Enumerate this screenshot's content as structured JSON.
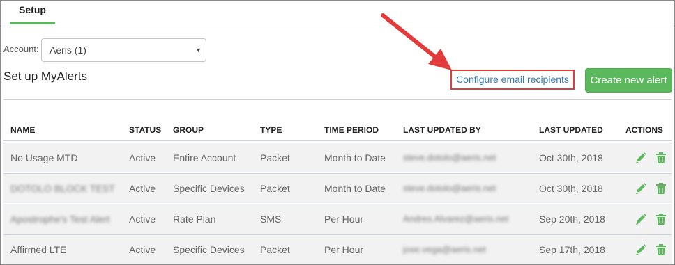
{
  "tabs": [
    {
      "label": "Setup"
    }
  ],
  "account": {
    "label": "Account:",
    "selected": "Aeris (1)"
  },
  "page": {
    "heading": "Set up MyAlerts"
  },
  "actions": {
    "configure_label": "Configure email recipients",
    "create_label": "Create new alert"
  },
  "table": {
    "headers": [
      "NAME",
      "STATUS",
      "GROUP",
      "TYPE",
      "TIME PERIOD",
      "LAST UPDATED BY",
      "LAST UPDATED",
      "ACTIONS"
    ],
    "rows": [
      [
        "No Usage MTD",
        "Active",
        "Entire Account",
        "Packet",
        "Month to Date",
        "steve.dotolo@aeris.net",
        "Oct 30th, 2018"
      ],
      [
        "DOTOLO BLOCK TEST",
        "Active",
        "Specific Devices",
        "Packet",
        "Month to Date",
        "steve.dotolo@aeris.net",
        "Oct 30th, 2018"
      ],
      [
        "Apostrophe's Test Alert",
        "Active",
        "Rate Plan",
        "SMS",
        "Per Hour",
        "Andres.Alvarez@aeris.net",
        "Sep 20th, 2018"
      ],
      [
        "Affirmed LTE",
        "Active",
        "Specific Devices",
        "Packet",
        "Per Hour",
        "jose.vega@aeris.net",
        "Sep 17th, 2018"
      ]
    ]
  },
  "colors": {
    "accent_green": "#5cb85c",
    "link_blue": "#337ab7",
    "highlight_red": "#e23b3b",
    "row_bg": "#f2f2f2"
  },
  "icons": {
    "edit": "pencil-icon",
    "delete": "trash-icon",
    "dropdown": "caret-down-icon"
  }
}
